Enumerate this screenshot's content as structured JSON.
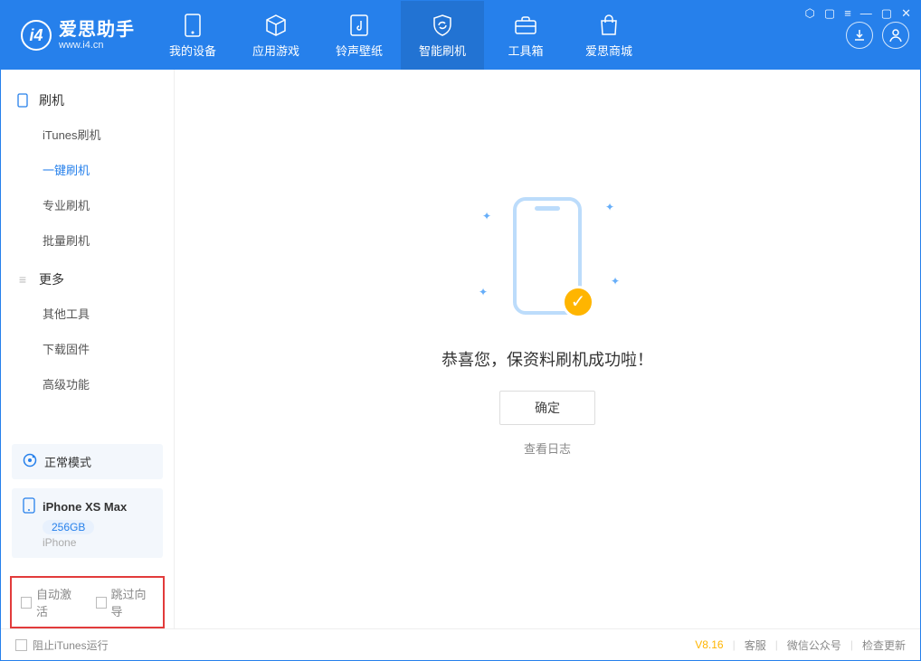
{
  "brand": {
    "title": "爱思助手",
    "subtitle": "www.i4.cn"
  },
  "nav": [
    {
      "label": "我的设备"
    },
    {
      "label": "应用游戏"
    },
    {
      "label": "铃声壁纸"
    },
    {
      "label": "智能刷机"
    },
    {
      "label": "工具箱"
    },
    {
      "label": "爱思商城"
    }
  ],
  "sidebar": {
    "section1": {
      "title": "刷机",
      "items": [
        "iTunes刷机",
        "一键刷机",
        "专业刷机",
        "批量刷机"
      ]
    },
    "section2": {
      "title": "更多",
      "items": [
        "其他工具",
        "下载固件",
        "高级功能"
      ]
    }
  },
  "device": {
    "mode": "正常模式",
    "name": "iPhone XS Max",
    "capacity": "256GB",
    "type": "iPhone"
  },
  "options": {
    "auto_activate": "自动激活",
    "skip_guide": "跳过向导"
  },
  "main": {
    "message": "恭喜您，保资料刷机成功啦！",
    "ok": "确定",
    "view_log": "查看日志"
  },
  "footer": {
    "block_itunes": "阻止iTunes运行",
    "version": "V8.16",
    "links": [
      "客服",
      "微信公众号",
      "检查更新"
    ]
  }
}
